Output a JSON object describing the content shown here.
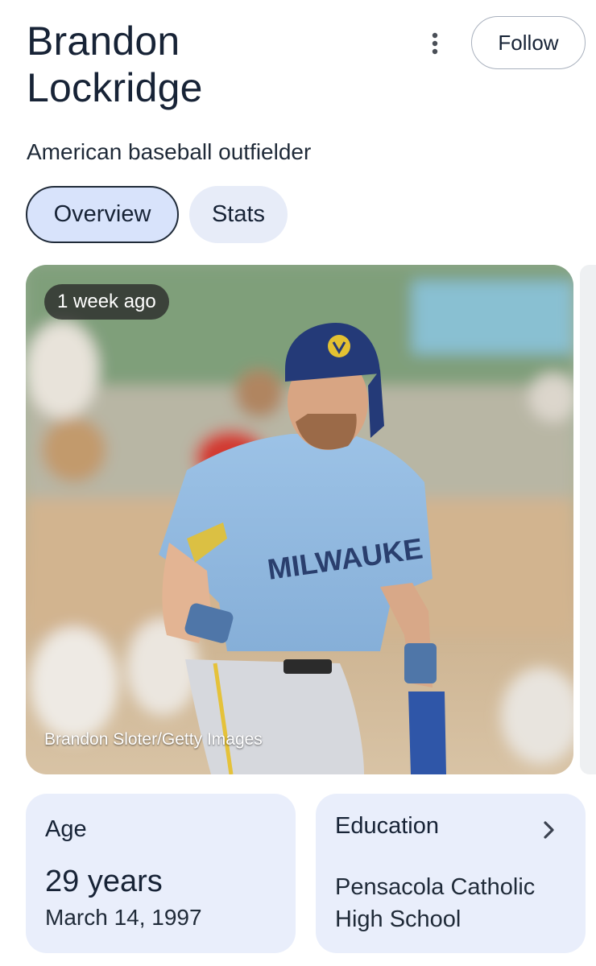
{
  "header": {
    "name_line1": "Brandon",
    "name_line2": "Lockridge",
    "subtitle": "American baseball outfielder",
    "follow_label": "Follow",
    "more_icon": "more-vert-icon"
  },
  "tabs": [
    {
      "label": "Overview",
      "active": true
    },
    {
      "label": "Stats",
      "active": false
    }
  ],
  "photo": {
    "time_label": "1 week ago",
    "credit": "Brandon Sloter/Getty Images",
    "jersey_text": "MILWAUKE"
  },
  "cards": {
    "age": {
      "label": "Age",
      "value": "29 years",
      "date": "March 14, 1997"
    },
    "education": {
      "label": "Education",
      "value": "Pensacola Catholic High School",
      "chevron_icon": "chevron-right-icon"
    }
  },
  "colors": {
    "title": "#172336",
    "tab_active_bg": "#d8e3fb",
    "tab_bg": "#e7ecf8",
    "card_bg": "#e9eefb"
  }
}
